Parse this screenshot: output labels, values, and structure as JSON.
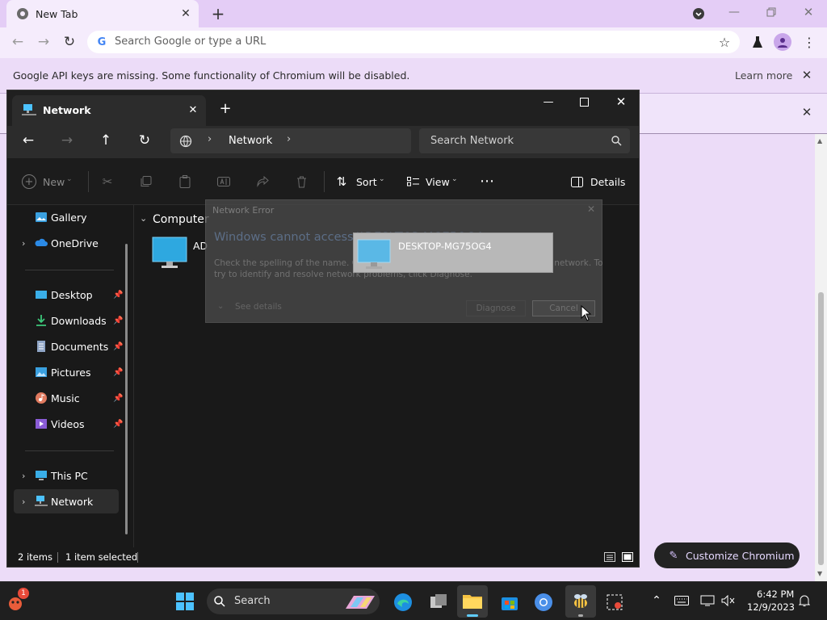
{
  "chrome": {
    "tab_title": "New Tab",
    "omnibox_placeholder": "Search Google or type a URL",
    "infobar_text": "Google API keys are missing. Some functionality of Chromium will be disabled.",
    "infobar_learn_more": "Learn more",
    "customize_label": "Customize Chromium"
  },
  "explorer": {
    "tab_title": "Network",
    "breadcrumb": "Network",
    "search_placeholder": "Search Network",
    "cmd": {
      "new": "New",
      "sort": "Sort",
      "view": "View",
      "details": "Details"
    },
    "sidebar": {
      "items": [
        {
          "label": "Gallery",
          "icon": "gallery-icon",
          "chevron": false,
          "pin": false
        },
        {
          "label": "OneDrive",
          "icon": "onedrive-icon",
          "chevron": true,
          "pin": false
        },
        {
          "label": "Desktop",
          "icon": "desktop-icon",
          "chevron": false,
          "pin": true
        },
        {
          "label": "Downloads",
          "icon": "downloads-icon",
          "chevron": false,
          "pin": true
        },
        {
          "label": "Documents",
          "icon": "documents-icon",
          "chevron": false,
          "pin": true
        },
        {
          "label": "Pictures",
          "icon": "pictures-icon",
          "chevron": false,
          "pin": true
        },
        {
          "label": "Music",
          "icon": "music-icon",
          "chevron": false,
          "pin": true
        },
        {
          "label": "Videos",
          "icon": "videos-icon",
          "chevron": false,
          "pin": true
        },
        {
          "label": "This PC",
          "icon": "this-pc-icon",
          "chevron": true,
          "pin": false
        },
        {
          "label": "Network",
          "icon": "network-icon",
          "chevron": true,
          "pin": false,
          "selected": true
        }
      ]
    },
    "group_header": "Computer",
    "item_partial_label": "AD",
    "status": {
      "items": "2 items",
      "selected": "1 item selected"
    }
  },
  "dialog": {
    "title": "Network Error",
    "heading": "Windows cannot access \\\\DESKTOP-MG75OG4",
    "body_line1": "Check the spelling of the name. Otherwise, there might be a problem with your network. To",
    "body_line2": "try to identify and resolve network problems, click Diagnose.",
    "see_details": "See details",
    "diagnose": "Diagnose",
    "cancel": "Cancel"
  },
  "drag_item": {
    "label": "DESKTOP-MG75OG4"
  },
  "taskbar": {
    "search_label": "Search",
    "notification_badge": "1",
    "time": "6:42 PM",
    "date": "12/9/2023"
  },
  "colors": {
    "chrome_tabstrip": "#e4cdf6",
    "chrome_toolbar": "#f5ecfc",
    "explorer_bg": "#191919",
    "accent": "#60cdff"
  }
}
